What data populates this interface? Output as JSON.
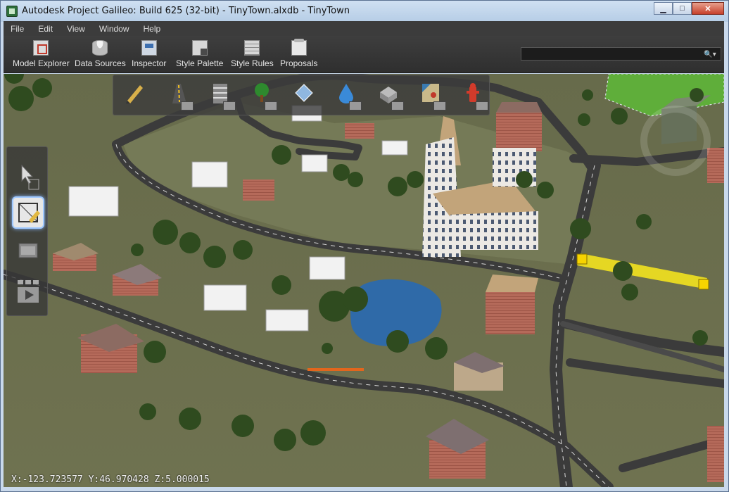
{
  "window": {
    "title": "Autodesk Project Galileo: Build 625 (32-bit) - TinyTown.alxdb - TinyTown",
    "minimize_glyph": "▁",
    "maximize_glyph": "□",
    "close_glyph": "✕"
  },
  "menu": {
    "items": [
      {
        "label": "File"
      },
      {
        "label": "Edit"
      },
      {
        "label": "View"
      },
      {
        "label": "Window"
      },
      {
        "label": "Help"
      }
    ]
  },
  "toolbar": {
    "items": [
      {
        "label": "Model Explorer",
        "icon": "model-explorer-icon"
      },
      {
        "label": "Data Sources",
        "icon": "data-sources-icon"
      },
      {
        "label": "Inspector",
        "icon": "inspector-icon"
      },
      {
        "label": "Style Palette",
        "icon": "style-palette-icon"
      },
      {
        "label": "Style Rules",
        "icon": "style-rules-icon"
      },
      {
        "label": "Proposals",
        "icon": "proposals-icon"
      }
    ]
  },
  "search": {
    "value": "",
    "button_glyph": "🔍▾"
  },
  "palette": {
    "tools": [
      {
        "icon": "pencil-icon"
      },
      {
        "icon": "road-icon"
      },
      {
        "icon": "rail-icon"
      },
      {
        "icon": "tree-icon"
      },
      {
        "icon": "terrain-icon"
      },
      {
        "icon": "water-icon"
      },
      {
        "icon": "building-icon"
      },
      {
        "icon": "parcel-icon"
      },
      {
        "icon": "hydrant-icon"
      }
    ]
  },
  "left_tools": [
    {
      "icon": "select-cursor-icon"
    },
    {
      "icon": "sketch-icon"
    },
    {
      "icon": "screenshot-icon"
    },
    {
      "icon": "play-icon"
    }
  ],
  "colors": {
    "ground": "#6b6e4e",
    "road": "#3f3f3f",
    "water": "#2f6aa8",
    "highlight": "#f3e21f",
    "lawn": "#5fae3a"
  },
  "status": {
    "coordinates": "X:-123.723577 Y:46.970428 Z:5.000015"
  }
}
